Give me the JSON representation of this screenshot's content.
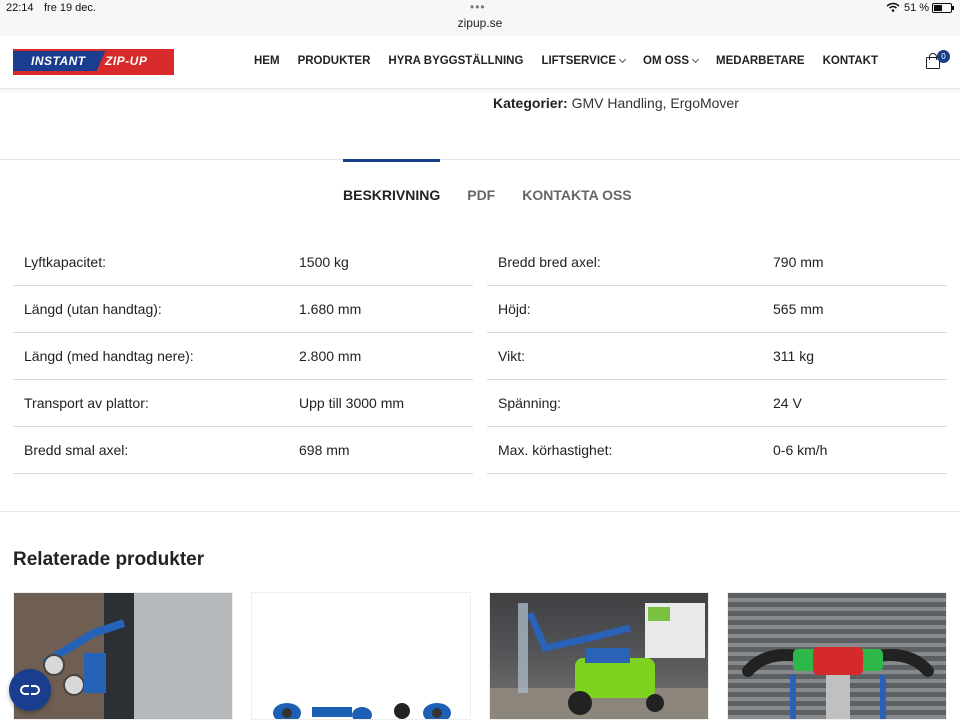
{
  "status_bar": {
    "time": "22:14",
    "date": "fre 19 dec.",
    "url": "zipup.se",
    "battery": "51 %",
    "battery_level": 0.51
  },
  "logo": {
    "part1": "INSTANT",
    "part2": "ZIP-UP"
  },
  "nav": {
    "items": [
      {
        "label": "HEM",
        "has_dropdown": false
      },
      {
        "label": "PRODUKTER",
        "has_dropdown": false
      },
      {
        "label": "HYRA BYGGSTÄLLNING",
        "has_dropdown": false
      },
      {
        "label": "LIFTSERVICE",
        "has_dropdown": true
      },
      {
        "label": "OM OSS",
        "has_dropdown": true
      },
      {
        "label": "MEDARBETARE",
        "has_dropdown": false
      },
      {
        "label": "KONTAKT",
        "has_dropdown": false
      }
    ],
    "cart_count": "0"
  },
  "categories": {
    "label": "Kategorier:",
    "links": [
      "GMV Handling",
      "ErgoMover"
    ]
  },
  "tabs": [
    {
      "label": "BESKRIVNING",
      "active": true
    },
    {
      "label": "PDF",
      "active": false
    },
    {
      "label": "KONTAKTA OSS",
      "active": false
    }
  ],
  "specs": {
    "left": [
      {
        "key": "Lyftkapacitet:",
        "value": "1500 kg"
      },
      {
        "key": "Längd (utan handtag):",
        "value": "1.680 mm"
      },
      {
        "key": "Längd (med handtag nere):",
        "value": "2.800 mm"
      },
      {
        "key": "Transport av plattor:",
        "value": "Upp till 3000 mm"
      },
      {
        "key": "Bredd smal axel:",
        "value": "698 mm"
      }
    ],
    "right": [
      {
        "key": "Bredd bred axel:",
        "value": "790 mm"
      },
      {
        "key": "Höjd:",
        "value": "565 mm"
      },
      {
        "key": "Vikt:",
        "value": "311 kg"
      },
      {
        "key": "Spänning:",
        "value": "24 V"
      },
      {
        "key": "Max. körhastighet:",
        "value": "0-6 km/h"
      }
    ]
  },
  "related": {
    "title": "Relaterade produkter"
  },
  "colors": {
    "brand_blue": "#1b3d8f",
    "brand_red": "#d82a2a"
  }
}
